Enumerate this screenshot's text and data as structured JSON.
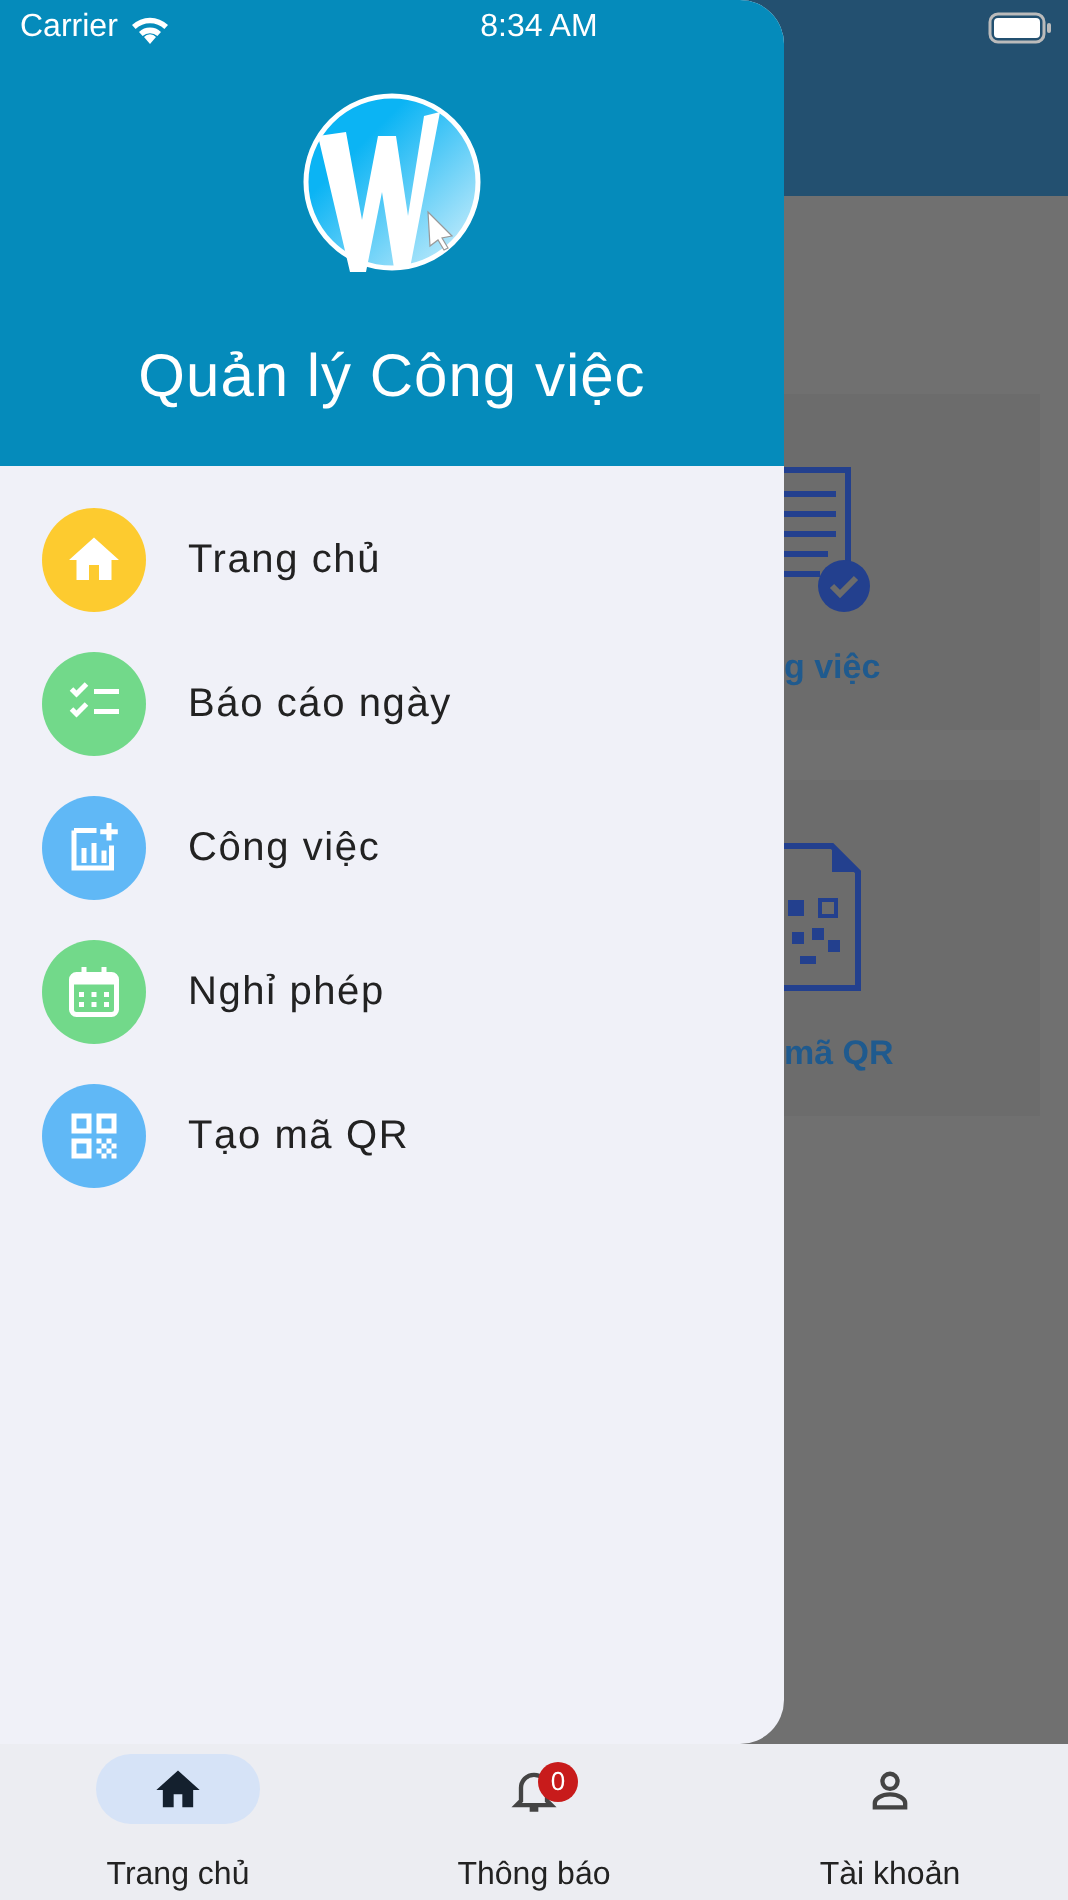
{
  "status_bar": {
    "carrier": "Carrier",
    "time": "8:34 AM"
  },
  "background": {
    "cards": [
      {
        "kind": "document",
        "label": "g việc"
      },
      {
        "kind": "qr",
        "label": "mã QR"
      }
    ]
  },
  "drawer": {
    "title": "Quản lý Công việc",
    "items": [
      {
        "kind": "home",
        "label": "Trang chủ",
        "color": "#fdcb2f"
      },
      {
        "kind": "checklist",
        "label": "Báo cáo ngày",
        "color": "#72d98a"
      },
      {
        "kind": "chart",
        "label": "Công việc",
        "color": "#60b8f6"
      },
      {
        "kind": "calendar",
        "label": "Nghỉ phép",
        "color": "#72d98a"
      },
      {
        "kind": "qr",
        "label": "Tạo mã QR",
        "color": "#60b8f6"
      }
    ]
  },
  "bottom_nav": [
    {
      "kind": "home",
      "label": "Trang chủ",
      "selected": true
    },
    {
      "kind": "bell",
      "label": "Thông báo",
      "selected": false,
      "badge": "0"
    },
    {
      "kind": "person",
      "label": "Tài khoản",
      "selected": false
    }
  ]
}
